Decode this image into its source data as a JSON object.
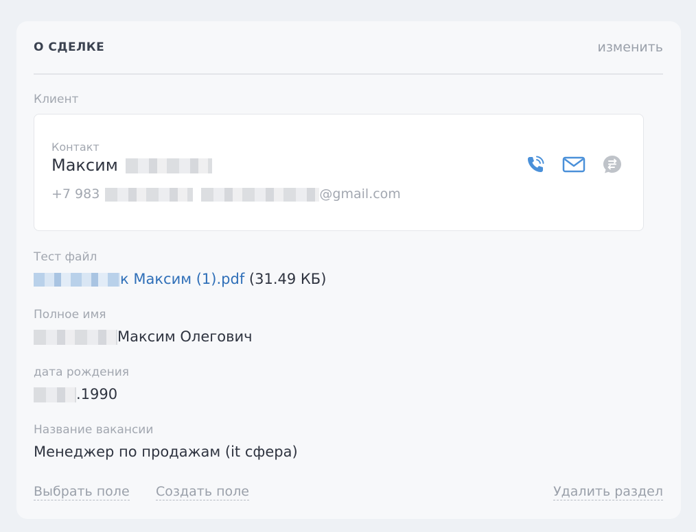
{
  "section": {
    "title": "О СДЕЛКЕ",
    "edit_label": "изменить"
  },
  "client": {
    "label": "Клиент",
    "contact_label": "Контакт",
    "name": "Максим",
    "phone_prefix": "+7 983",
    "email_suffix": "@gmail.com",
    "icons": [
      "phone-icon",
      "mail-icon",
      "chat-icon"
    ]
  },
  "fields": {
    "test_file": {
      "label": "Тест файл",
      "file_name": "к Максим (1).pdf",
      "file_size": "(31.49 КБ)"
    },
    "full_name": {
      "label": "Полное имя",
      "value": "Максим Олегович"
    },
    "birth_date": {
      "label": "дата рождения",
      "value": ".1990"
    },
    "vacancy": {
      "label": "Название вакансии",
      "value": "Менеджер по продажам (it сфера)"
    }
  },
  "footer": {
    "choose_field": "Выбрать поле",
    "create_field": "Создать поле",
    "delete_section": "Удалить раздел"
  },
  "colors": {
    "accent_blue": "#4a90d9",
    "link_blue": "#2f6fb8",
    "chat_gray": "#bfc3c9"
  }
}
